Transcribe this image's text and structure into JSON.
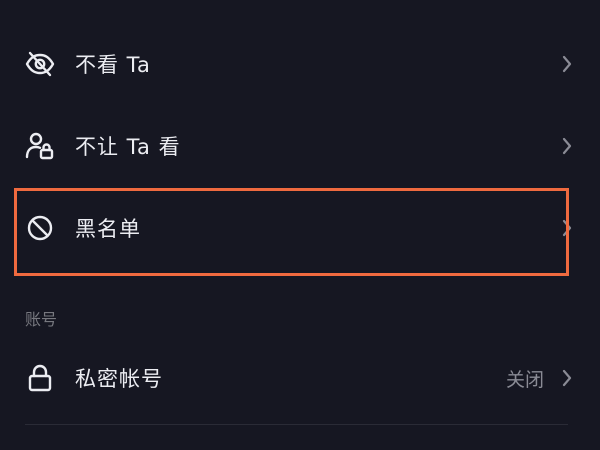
{
  "settings": {
    "items": [
      {
        "label": "不看 Ta",
        "icon": "eye-off-icon"
      },
      {
        "label": "不让 Ta 看",
        "icon": "user-lock-icon"
      },
      {
        "label": "黑名单",
        "icon": "block-icon"
      }
    ]
  },
  "account": {
    "header": "账号",
    "private_account": {
      "label": "私密帐号",
      "value": "关闭",
      "icon": "lock-icon"
    }
  },
  "colors": {
    "background": "#161722",
    "highlight": "#ef6a3f",
    "text": "#ecedf2",
    "muted": "#8a8b95"
  }
}
